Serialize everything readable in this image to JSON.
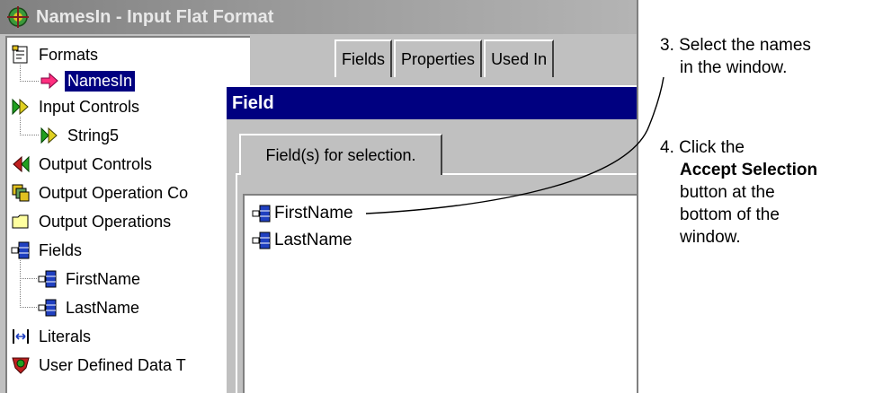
{
  "window": {
    "title": "NamesIn - Input Flat Format"
  },
  "tree": {
    "items": [
      {
        "label": "Formats",
        "icon": "formats-icon"
      },
      {
        "label": "NamesIn",
        "icon": "arrow-right-icon"
      },
      {
        "label": "Input Controls",
        "icon": "input-controls-icon"
      },
      {
        "label": "String5",
        "icon": "input-controls-icon"
      },
      {
        "label": "Output Controls",
        "icon": "output-controls-icon"
      },
      {
        "label": "Output Operation Co",
        "icon": "output-operation-icon"
      },
      {
        "label": "Output Operations",
        "icon": "folder-icon"
      },
      {
        "label": "Fields",
        "icon": "field-icon"
      },
      {
        "label": "FirstName",
        "icon": "field-icon"
      },
      {
        "label": "LastName",
        "icon": "field-icon"
      },
      {
        "label": "Literals",
        "icon": "literals-icon"
      },
      {
        "label": "User Defined Data T",
        "icon": "user-defined-icon"
      }
    ]
  },
  "tabs": [
    "Fields",
    "Properties",
    "Used In"
  ],
  "dialog": {
    "title": "Field",
    "tab": "Field(s) for selection.",
    "fields": [
      "FirstName",
      "LastName"
    ]
  },
  "annotations": {
    "step3_line1": "3. Select the names",
    "step3_line2": "in the window.",
    "step4_line1": "4. Click the",
    "step4_bold": "Accept Selection",
    "step4_line3": "button at the",
    "step4_line4": "bottom of the",
    "step4_line5": "window."
  },
  "colors": {
    "selection": "#000080",
    "dialog_title": "#000080",
    "window_face": "#c0c0c0"
  }
}
